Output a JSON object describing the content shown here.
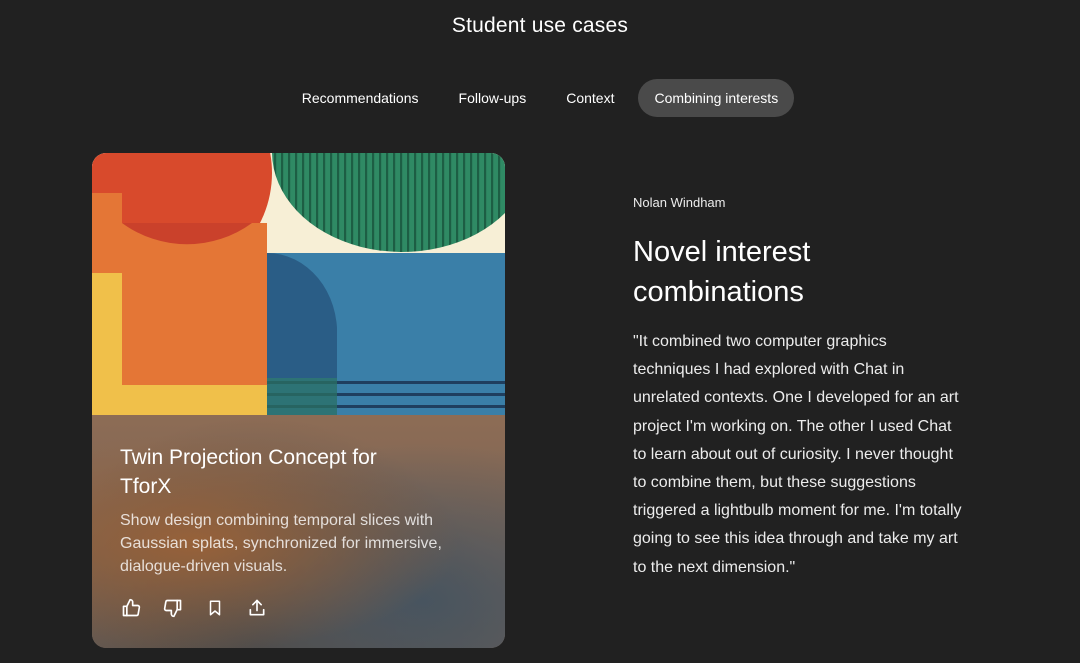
{
  "header": {
    "title": "Student use cases"
  },
  "tabs": [
    {
      "label": "Recommendations",
      "active": false
    },
    {
      "label": "Follow-ups",
      "active": false
    },
    {
      "label": "Context",
      "active": false
    },
    {
      "label": "Combining interests",
      "active": true
    }
  ],
  "card": {
    "title": "Twin Projection Concept for TforX",
    "description": "Show design combining temporal slices with Gaussian splats, synchronized for immersive, dialogue-driven visuals.",
    "actions": [
      {
        "name": "thumbs-up",
        "icon": "thumbs-up-icon"
      },
      {
        "name": "thumbs-down",
        "icon": "thumbs-down-icon"
      },
      {
        "name": "bookmark",
        "icon": "bookmark-icon"
      },
      {
        "name": "share",
        "icon": "share-icon"
      }
    ]
  },
  "testimonial": {
    "author": "Nolan Windham",
    "headline": "Novel interest combinations",
    "quote": "\"It combined two computer graphics techniques I had explored with Chat in unrelated contexts. One I developed for an art project I'm working on. The other I used Chat to learn about out of curiosity. I never thought to combine them, but these suggestions triggered a lightbulb moment for me. I'm totally going to see this idea through and take my art to the next dimension.\""
  },
  "colors": {
    "background": "#212121",
    "active_tab": "#4a4a4a",
    "art_red": "#d84a2c",
    "art_orange": "#e47636",
    "art_yellow": "#f0c04a",
    "art_cream": "#f7efd6",
    "art_teal": "#2f8a64",
    "art_blue": "#3a7fa8"
  }
}
